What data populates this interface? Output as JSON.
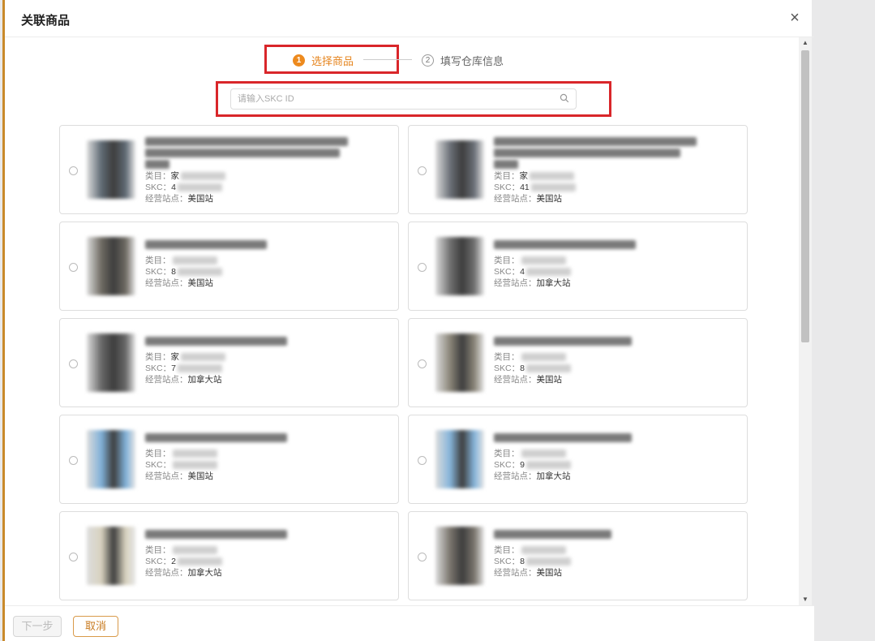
{
  "dialog": {
    "title": "关联商品",
    "close_label": "×"
  },
  "steps": [
    {
      "num": "1",
      "label": "选择商品",
      "active": true
    },
    {
      "num": "2",
      "label": "填写仓库信息",
      "active": false
    }
  ],
  "search": {
    "placeholder": "请输入SKC ID",
    "value": ""
  },
  "labels": {
    "category": "类目：",
    "skc": "SKC：",
    "site": "经营站点："
  },
  "products": [
    {
      "title": "Bath Mats Bathroom ... Absorbent Plush Rug",
      "category_prefix": "家",
      "skc_prefix": "4",
      "site": "美国站",
      "thumb_color": "#5f6a74"
    },
    {
      "title": "B...",
      "category_prefix": "家",
      "skc_prefix": "41",
      "site": "美国站",
      "thumb_color": "#6b7078"
    },
    {
      "title": "",
      "category_prefix": "",
      "skc_prefix": "8",
      "site": "美国站",
      "thumb_color": "#6e6a62"
    },
    {
      "title": "",
      "category_prefix": "",
      "skc_prefix": "4",
      "site": "加拿大站",
      "thumb_color": "#707070"
    },
    {
      "title": "",
      "category_prefix": "家",
      "skc_prefix": "7",
      "site": "加拿大站",
      "thumb_color": "#686868"
    },
    {
      "title": "",
      "category_prefix": "",
      "skc_prefix": "8",
      "site": "美国站",
      "thumb_color": "#8a8578"
    },
    {
      "title": "",
      "category_prefix": "",
      "skc_prefix": "",
      "site": "美国站",
      "thumb_color": "#7fb0d8"
    },
    {
      "title": "",
      "category_prefix": "",
      "skc_prefix": "9",
      "site": "加拿大站",
      "thumb_color": "#85b4da"
    },
    {
      "title": "",
      "category_prefix": "",
      "skc_prefix": "2",
      "site": "加拿大站",
      "thumb_color": "#d8d2bf"
    },
    {
      "title": "m",
      "category_prefix": "",
      "skc_prefix": "8",
      "site": "美国站",
      "thumb_color": "#7a756d"
    }
  ],
  "footer": {
    "next_label": "下一步",
    "cancel_label": "取消"
  },
  "colors": {
    "accent": "#ed8a1e",
    "highlight": "#d9262a"
  }
}
